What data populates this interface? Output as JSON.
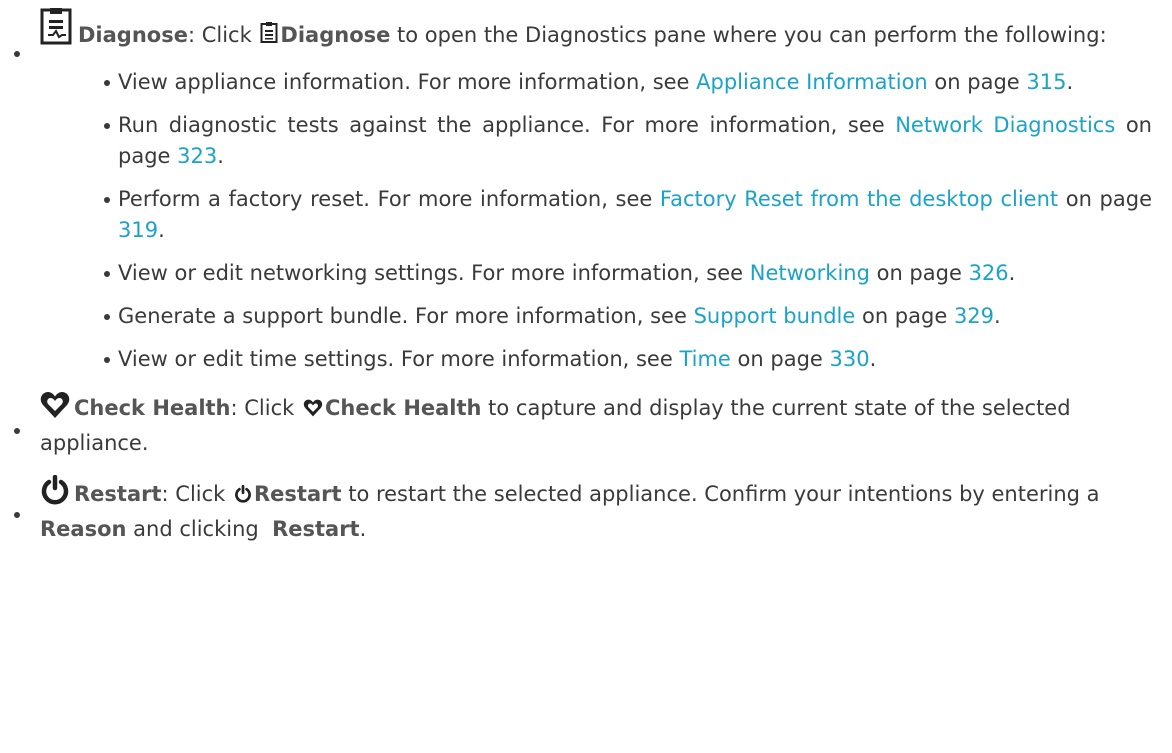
{
  "diagnose": {
    "term": "Diagnose",
    "pre": ": Click ",
    "inline_term": "Diagnose",
    "post": " to open the Diagnostics pane where you can perform the following:",
    "icon": "diagnose-report-icon",
    "items": [
      {
        "text": "View appliance information. For more information, see ",
        "link": "Appliance Information",
        "mid": " on page ",
        "page": "315",
        "end": "."
      },
      {
        "text": "Run diagnostic tests against the appliance. For more information, see ",
        "link": "Network Diagnostics",
        "mid": " on page ",
        "page": "323",
        "end": "."
      },
      {
        "text": "Perform a factory reset. For more information, see ",
        "link": "Factory Reset from the desktop client",
        "mid": " on page ",
        "page": "319",
        "end": "."
      },
      {
        "text": "View or edit networking settings. For more information, see ",
        "link": "Networking",
        "mid": " on page ",
        "page": "326",
        "end": "."
      },
      {
        "text": "Generate a support bundle. For more information, see ",
        "link": "Support bundle",
        "mid": " on page ",
        "page": "329",
        "end": "."
      },
      {
        "text": "View or edit time settings. For more information, see ",
        "link": "Time",
        "mid": " on page ",
        "page": "330",
        "end": "."
      }
    ]
  },
  "health": {
    "term": "Check Health",
    "pre": ": Click ",
    "inline_term": "Check Health",
    "post": " to capture and display the current state of the selected appliance.",
    "icon": "heart-icon"
  },
  "restart": {
    "term": "Restart",
    "pre": ": Click ",
    "inline_term": "Restart",
    "post1": " to restart the selected appliance. Confirm your intentions by entering a ",
    "reason": "Reason",
    "post2": " and clicking  ",
    "final_term": "Restart",
    "end": ".",
    "icon": "power-icon"
  },
  "colors": {
    "text": "#3a3a3a",
    "link": "#1aa3c9"
  }
}
